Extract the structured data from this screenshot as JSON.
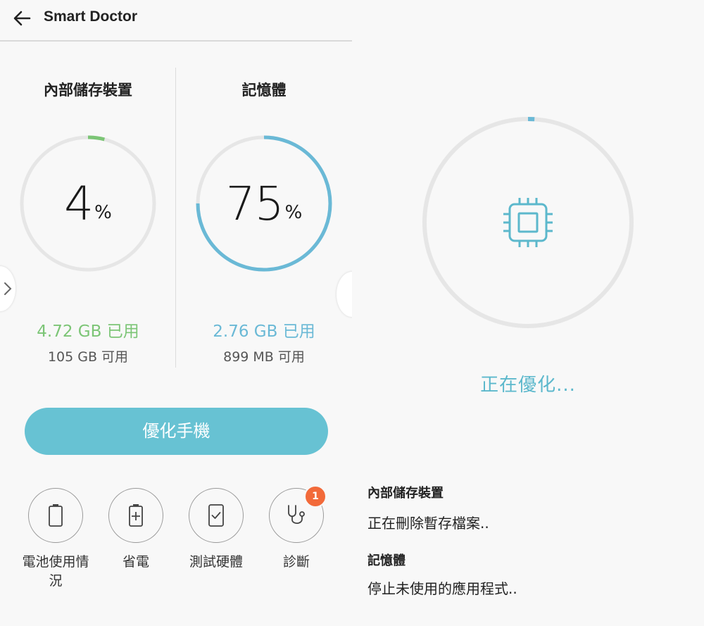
{
  "header": {
    "title": "Smart Doctor"
  },
  "storage": {
    "title": "內部儲存裝置",
    "percent": "4",
    "percent_sign": "%",
    "used": "4.72 GB 已用",
    "free": "105 GB 可用",
    "fill_fraction": 0.04
  },
  "memory": {
    "title": "記憶體",
    "percent": "75",
    "percent_sign": "%",
    "used": "2.76 GB 已用",
    "free": "899 MB 可用",
    "fill_fraction": 0.75
  },
  "optimize_button": {
    "label": "優化手機"
  },
  "tools": [
    {
      "label": "電池使用情況",
      "icon": "battery-icon"
    },
    {
      "label": "省電",
      "icon": "battery-charge-icon"
    },
    {
      "label": "測試硬體",
      "icon": "phone-check-icon"
    },
    {
      "label": "診斷",
      "icon": "stethoscope-icon",
      "badge": "1"
    }
  ],
  "progress": {
    "status": "正在優化...",
    "fill_fraction": 0.01,
    "icon": "chip-icon"
  },
  "tasks": [
    {
      "title": "內部儲存裝置",
      "status": "正在刪除暫存檔案.."
    },
    {
      "title": "記憶體",
      "status": "停止未使用的應用程式.."
    }
  ],
  "colors": {
    "storage_green": "#7cc576",
    "memory_blue": "#6ab9d6",
    "ring_gray": "#e6e6e6",
    "button_teal": "#67c2d3",
    "badge_orange": "#f26a3a"
  }
}
